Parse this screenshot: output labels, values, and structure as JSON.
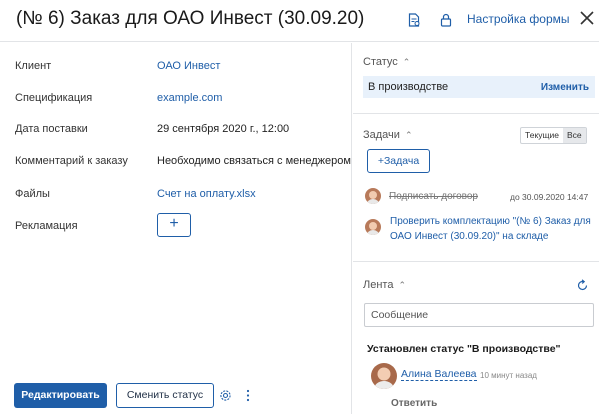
{
  "header": {
    "title": "(№ 6) Заказ для ОАО Инвест (30.09.20)",
    "form_settings_label": "Настройка формы",
    "icons": [
      "document-settings-icon",
      "lock-icon",
      "close-icon"
    ]
  },
  "fields": [
    {
      "label": "Клиент",
      "value": "ОАО Инвест",
      "is_link": true
    },
    {
      "label": "Спецификация",
      "value": "example.com",
      "is_link": true
    },
    {
      "label": "Дата поставки",
      "value": "29 сентября 2020 г., 12:00",
      "is_link": false
    },
    {
      "label": "Комментарий к заказу",
      "value": "Необходимо связаться с менеджером",
      "is_link": false
    },
    {
      "label": "Файлы",
      "value": "Счет на оплату.xlsx",
      "is_link": true
    },
    {
      "label": "Рекламация",
      "value": "+",
      "is_link": false
    }
  ],
  "footer": {
    "edit_label": "Редактировать",
    "change_status_label": "Сменить статус"
  },
  "status": {
    "heading": "Статус",
    "value": "В производстве",
    "change_label": "Изменить"
  },
  "tasks": {
    "heading": "Задачи",
    "filters": [
      "Текущие",
      "Все"
    ],
    "active_filter": "Все",
    "add_label": "+Задача",
    "items": [
      {
        "text": "Подписать договор",
        "due": "до 30.09.2020 14:47",
        "done": true
      },
      {
        "text": "Проверить комплектацию \"(№ 6) Заказ для ОАО Инвест (30.09.20)\" на складе",
        "due": "",
        "done": false
      }
    ]
  },
  "feed": {
    "heading": "Лента",
    "message_placeholder": "Сообщение",
    "entry": {
      "title": "Установлен статус \"В производстве\"",
      "author": "Алина Валеева",
      "time": "10 минут назад",
      "reply_label": "Ответить"
    }
  },
  "colors": {
    "accent": "#1f5ea8",
    "status_bg": "#e8f1fb"
  }
}
